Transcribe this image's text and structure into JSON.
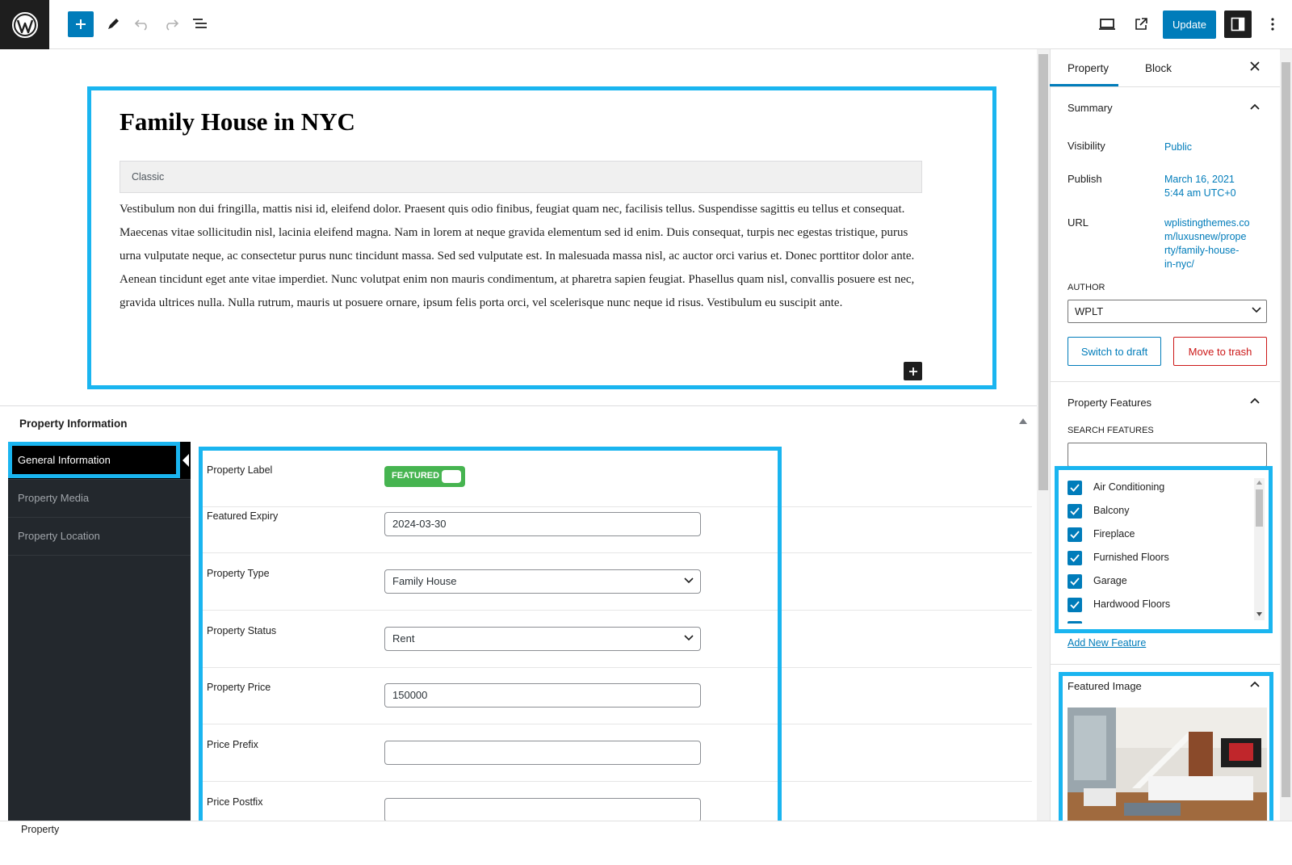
{
  "toolbar": {
    "update_label": "Update"
  },
  "editor": {
    "post_title": "Family House in NYC",
    "classic_label": "Classic",
    "body_text": "Vestibulum non dui fringilla, mattis nisi id, eleifend dolor. Praesent quis odio finibus, feugiat quam nec, facilisis tellus. Suspendisse sagittis eu tellus et consequat. Maecenas vitae sollicitudin nisl, lacinia eleifend magna. Nam in lorem at neque gravida elementum sed id enim. Duis consequat, turpis nec egestas tristique, purus urna vulputate neque, ac consectetur purus nunc tincidunt massa. Sed sed vulputate est. In malesuada massa nisl, ac auctor orci varius et. Donec porttitor dolor ante. Aenean tincidunt eget ante vitae imperdiet. Nunc volutpat enim non mauris condimentum, at pharetra sapien feugiat. Phasellus quam nisl, convallis posuere est nec, gravida ultrices nulla. Nulla rutrum, mauris ut posuere ornare, ipsum felis porta orci, vel scelerisque nunc neque id risus. Vestibulum eu suscipit ante."
  },
  "metabox": {
    "title": "Property Information",
    "nav": [
      {
        "label": "General Information"
      },
      {
        "label": "Property Media"
      },
      {
        "label": "Property Location"
      }
    ],
    "fields": {
      "label": {
        "label": "Property Label",
        "toggle_text": "FEATURED"
      },
      "expiry": {
        "label": "Featured Expiry",
        "value": "2024-03-30"
      },
      "type": {
        "label": "Property Type",
        "value": "Family House"
      },
      "status": {
        "label": "Property Status",
        "value": "Rent"
      },
      "price": {
        "label": "Property Price",
        "value": "150000"
      },
      "prefix": {
        "label": "Price Prefix",
        "value": ""
      },
      "postfix": {
        "label": "Price Postfix",
        "value": ""
      }
    }
  },
  "sidebar": {
    "tabs": {
      "property": "Property",
      "block": "Block"
    },
    "summary": {
      "title": "Summary",
      "visibility_label": "Visibility",
      "visibility_value": "Public",
      "publish_label": "Publish",
      "publish_date": "March 16, 2021",
      "publish_time": "5:44 am UTC+0",
      "url_label": "URL",
      "url_lines": [
        "wplistingthemes.co",
        "m/luxusnew/prope",
        "rty/family-house-",
        "in-nyc/"
      ],
      "author_label": "AUTHOR",
      "author_value": "WPLT",
      "switch_draft": "Switch to draft",
      "move_trash": "Move to trash"
    },
    "features": {
      "title": "Property Features",
      "search_label": "SEARCH FEATURES",
      "items": [
        "Air Conditioning",
        "Balcony",
        "Fireplace",
        "Furnished Floors",
        "Garage",
        "Hardwood Floors"
      ],
      "add_new": "Add New Feature"
    },
    "featured_image": {
      "title": "Featured Image"
    }
  },
  "statusbar": {
    "text": "Property"
  },
  "colors": {
    "accent": "#007cba",
    "highlight": "#1ab5f0",
    "toggle_green": "#46b450",
    "danger": "#cc1818"
  }
}
